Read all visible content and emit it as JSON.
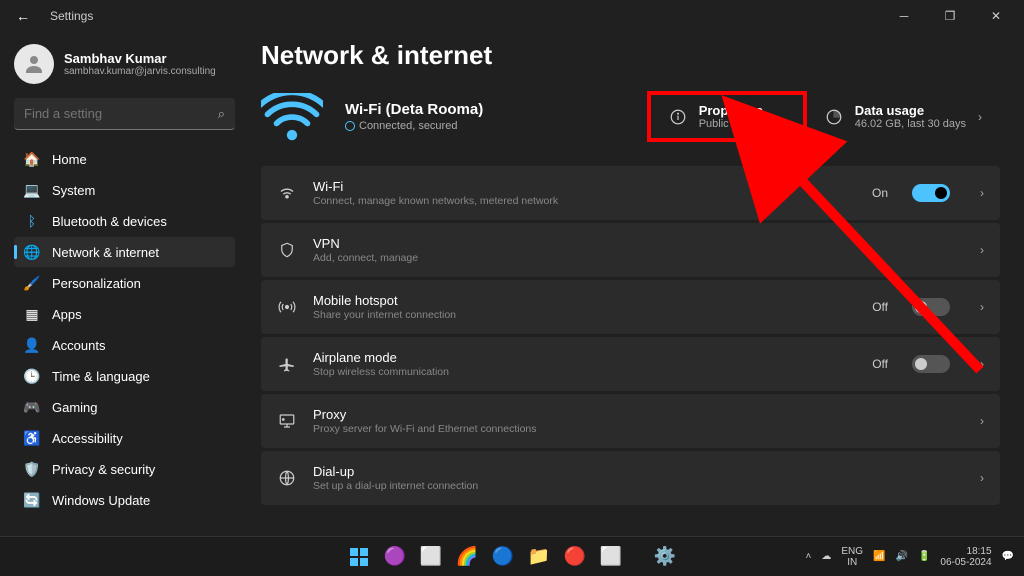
{
  "titlebar": {
    "back": "←",
    "app": "Settings"
  },
  "user": {
    "name": "Sambhav Kumar",
    "email": "sambhav.kumar@jarvis.consulting"
  },
  "search": {
    "placeholder": "Find a setting"
  },
  "nav": [
    {
      "id": "home",
      "label": "Home",
      "icon": "🏠"
    },
    {
      "id": "system",
      "label": "System",
      "icon": "💻"
    },
    {
      "id": "bluetooth",
      "label": "Bluetooth & devices",
      "icon": "ᛒ",
      "iconColor": "#4cc2ff"
    },
    {
      "id": "network",
      "label": "Network & internet",
      "icon": "🌐",
      "active": true
    },
    {
      "id": "personalization",
      "label": "Personalization",
      "icon": "🖌️"
    },
    {
      "id": "apps",
      "label": "Apps",
      "icon": "▦"
    },
    {
      "id": "accounts",
      "label": "Accounts",
      "icon": "👤"
    },
    {
      "id": "time",
      "label": "Time & language",
      "icon": "🕒"
    },
    {
      "id": "gaming",
      "label": "Gaming",
      "icon": "🎮"
    },
    {
      "id": "accessibility",
      "label": "Accessibility",
      "icon": "♿"
    },
    {
      "id": "privacy",
      "label": "Privacy & security",
      "icon": "🛡️"
    },
    {
      "id": "update",
      "label": "Windows Update",
      "icon": "🔄"
    }
  ],
  "page": {
    "title": "Network & internet"
  },
  "wifi_status": {
    "name": "Wi-Fi (Deta Rooma)",
    "state": "Connected, secured"
  },
  "properties_card": {
    "title": "Properties",
    "sub": "Public network"
  },
  "usage_card": {
    "title": "Data usage",
    "sub": "46.02 GB, last 30 days"
  },
  "rows": [
    {
      "id": "wifi",
      "icon": "wifi",
      "title": "Wi-Fi",
      "sub": "Connect, manage known networks, metered network",
      "toggle": "on",
      "toggle_label": "On"
    },
    {
      "id": "vpn",
      "icon": "shield",
      "title": "VPN",
      "sub": "Add, connect, manage"
    },
    {
      "id": "hotspot",
      "icon": "hotspot",
      "title": "Mobile hotspot",
      "sub": "Share your internet connection",
      "toggle": "off",
      "toggle_label": "Off"
    },
    {
      "id": "airplane",
      "icon": "airplane",
      "title": "Airplane mode",
      "sub": "Stop wireless communication",
      "toggle": "off",
      "toggle_label": "Off"
    },
    {
      "id": "proxy",
      "icon": "proxy",
      "title": "Proxy",
      "sub": "Proxy server for Wi-Fi and Ethernet connections"
    },
    {
      "id": "dialup",
      "icon": "dialup",
      "title": "Dial-up",
      "sub": "Set up a dial-up internet connection"
    }
  ],
  "taskbar": {
    "lang1": "ENG",
    "lang2": "IN",
    "time": "18:15",
    "date": "06-05-2024"
  }
}
